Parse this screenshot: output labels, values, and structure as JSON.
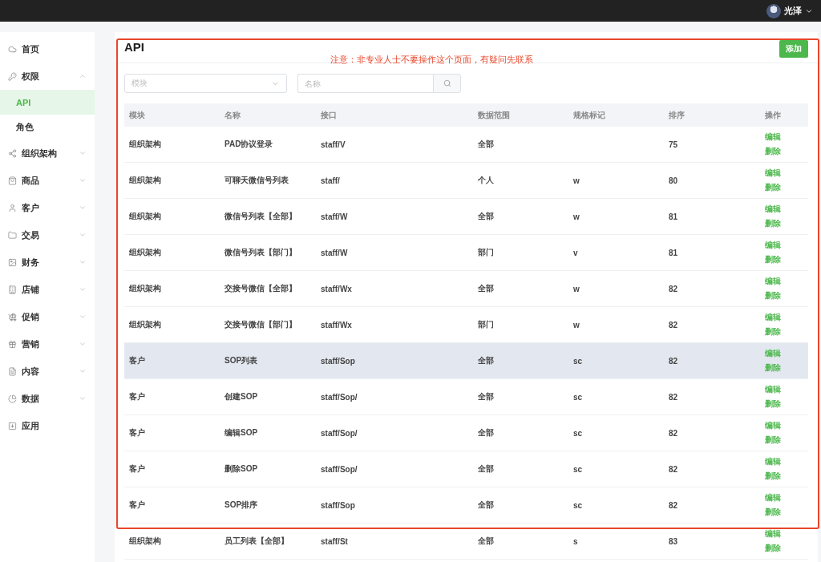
{
  "topbar": {
    "user_name": "光泽"
  },
  "sidebar": {
    "items": [
      {
        "label": "首页",
        "kind": "link"
      },
      {
        "label": "权限",
        "kind": "group",
        "expanded": true,
        "children": [
          {
            "label": "API",
            "selected": true
          },
          {
            "label": "角色",
            "selected": false
          }
        ]
      },
      {
        "label": "组织架构",
        "kind": "group",
        "expanded": false
      },
      {
        "label": "商品",
        "kind": "group",
        "expanded": false
      },
      {
        "label": "客户",
        "kind": "group",
        "expanded": false
      },
      {
        "label": "交易",
        "kind": "group",
        "expanded": false
      },
      {
        "label": "财务",
        "kind": "group",
        "expanded": false
      },
      {
        "label": "店铺",
        "kind": "group",
        "expanded": false
      },
      {
        "label": "促销",
        "kind": "group",
        "expanded": false
      },
      {
        "label": "营销",
        "kind": "group",
        "expanded": false
      },
      {
        "label": "内容",
        "kind": "group",
        "expanded": false
      },
      {
        "label": "数据",
        "kind": "group",
        "expanded": false
      },
      {
        "label": "应用",
        "kind": "link"
      }
    ]
  },
  "page": {
    "title": "API",
    "notice": "注意：非专业人士不要操作这个页面，有疑问先联系",
    "add_button": "添加"
  },
  "filters": {
    "module_select": {
      "placeholder": "模块"
    },
    "name_search": {
      "placeholder": "名称"
    }
  },
  "table": {
    "columns": [
      "模块",
      "名称",
      "接口",
      "数据范围",
      "规格标记",
      "排序",
      "操作"
    ],
    "rows": [
      {
        "module": "组织架构",
        "name": "PAD协议登录",
        "api": "staff/V",
        "scope": "全部",
        "spec": "",
        "order": "75",
        "highlighted": false,
        "actions": [
          "编辑",
          "删除"
        ]
      },
      {
        "module": "组织架构",
        "name": "可聊天微信号列表",
        "api": "staff/",
        "scope": "个人",
        "spec": "w",
        "order": "80",
        "highlighted": false,
        "actions": [
          "编辑",
          "删除"
        ]
      },
      {
        "module": "组织架构",
        "name": "微信号列表【全部】",
        "api": "staff/W",
        "scope": "全部",
        "spec": "w",
        "order": "81",
        "highlighted": false,
        "actions": [
          "编辑",
          "删除"
        ]
      },
      {
        "module": "组织架构",
        "name": "微信号列表【部门】",
        "api": "staff/W",
        "scope": "部门",
        "spec": "v",
        "order": "81",
        "highlighted": false,
        "actions": [
          "编辑",
          "删除"
        ]
      },
      {
        "module": "组织架构",
        "name": "交接号微信【全部】",
        "api": "staff/Wx",
        "scope": "全部",
        "spec": "w",
        "order": "82",
        "highlighted": false,
        "actions": [
          "编辑",
          "删除"
        ]
      },
      {
        "module": "组织架构",
        "name": "交接号微信【部门】",
        "api": "staff/Wx",
        "scope": "部门",
        "spec": "w",
        "order": "82",
        "highlighted": false,
        "actions": [
          "编辑",
          "删除"
        ]
      },
      {
        "module": "客户",
        "name": "SOP列表",
        "api": "staff/Sop",
        "scope": "全部",
        "spec": "sc",
        "order": "82",
        "highlighted": true,
        "actions": [
          "编辑",
          "删除"
        ]
      },
      {
        "module": "客户",
        "name": "创建SOP",
        "api": "staff/Sop/",
        "scope": "全部",
        "spec": "sc",
        "order": "82",
        "highlighted": false,
        "actions": [
          "编辑",
          "删除"
        ]
      },
      {
        "module": "客户",
        "name": "编辑SOP",
        "api": "staff/Sop/",
        "scope": "全部",
        "spec": "sc",
        "order": "82",
        "highlighted": false,
        "actions": [
          "编辑",
          "删除"
        ]
      },
      {
        "module": "客户",
        "name": "删除SOP",
        "api": "staff/Sop/",
        "scope": "全部",
        "spec": "sc",
        "order": "82",
        "highlighted": false,
        "actions": [
          "编辑",
          "删除"
        ]
      },
      {
        "module": "客户",
        "name": "SOP排序",
        "api": "staff/Sop",
        "scope": "全部",
        "spec": "sc",
        "order": "82",
        "highlighted": false,
        "actions": [
          "编辑",
          "删除"
        ]
      },
      {
        "module": "组织架构",
        "name": "员工列表【全部】",
        "api": "staff/St",
        "scope": "全部",
        "spec": "s",
        "order": "83",
        "highlighted": false,
        "actions": [
          "编辑",
          "删除"
        ]
      }
    ]
  }
}
